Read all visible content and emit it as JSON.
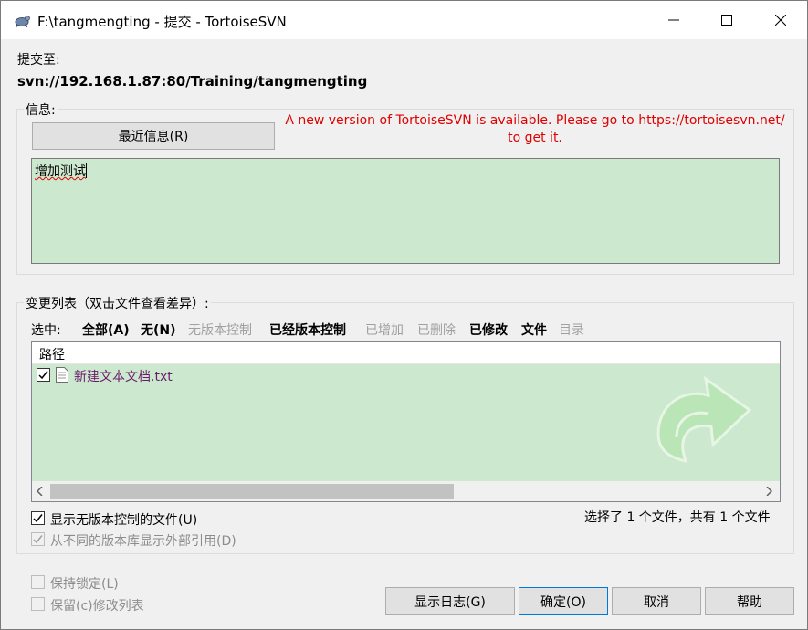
{
  "window": {
    "title": "F:\\tangmengting - 提交 - TortoiseSVN",
    "buttons": {
      "minimize": "─",
      "maximize": "☐",
      "close": "✕"
    }
  },
  "commit_to": {
    "label": "提交至:",
    "url": "svn://192.168.1.87:80/Training/tangmengting"
  },
  "message_group": {
    "label": "信息:",
    "recent_button": "最近信息(R)",
    "update_notice": "A new version of TortoiseSVN is available. Please go to https://tortoisesvn.net/ to get it.",
    "message_text": "增加测试"
  },
  "changes_group": {
    "label": "变更列表（双击文件查看差异）:",
    "select_label": "选中:",
    "filters": [
      {
        "label": "全部(A)",
        "enabled": true
      },
      {
        "label": "无(N)",
        "enabled": true
      },
      {
        "label": "无版本控制",
        "enabled": false
      },
      {
        "label": "已经版本控制",
        "enabled": true
      },
      {
        "label": "已增加",
        "enabled": false
      },
      {
        "label": "已删除",
        "enabled": false
      },
      {
        "label": "已修改",
        "enabled": true
      },
      {
        "label": "文件",
        "enabled": true
      },
      {
        "label": "目录",
        "enabled": false
      }
    ],
    "column_header": "路径",
    "files": [
      {
        "name": "新建文本文档.txt",
        "checked": true
      }
    ],
    "show_unversioned": "显示无版本控制的文件(U)",
    "show_externals": "从不同的版本库显示外部引用(D)",
    "selection_status": "选择了 1 个文件，共有 1 个文件"
  },
  "options": {
    "keep_locks": "保持锁定(L)",
    "keep_changelists": "保留(c)修改列表"
  },
  "buttons": {
    "show_log": "显示日志(G)",
    "ok": "确定(O)",
    "cancel": "取消",
    "help": "帮助"
  },
  "colors": {
    "accent_green": "#cce8cf",
    "notice_red": "#e00000"
  }
}
